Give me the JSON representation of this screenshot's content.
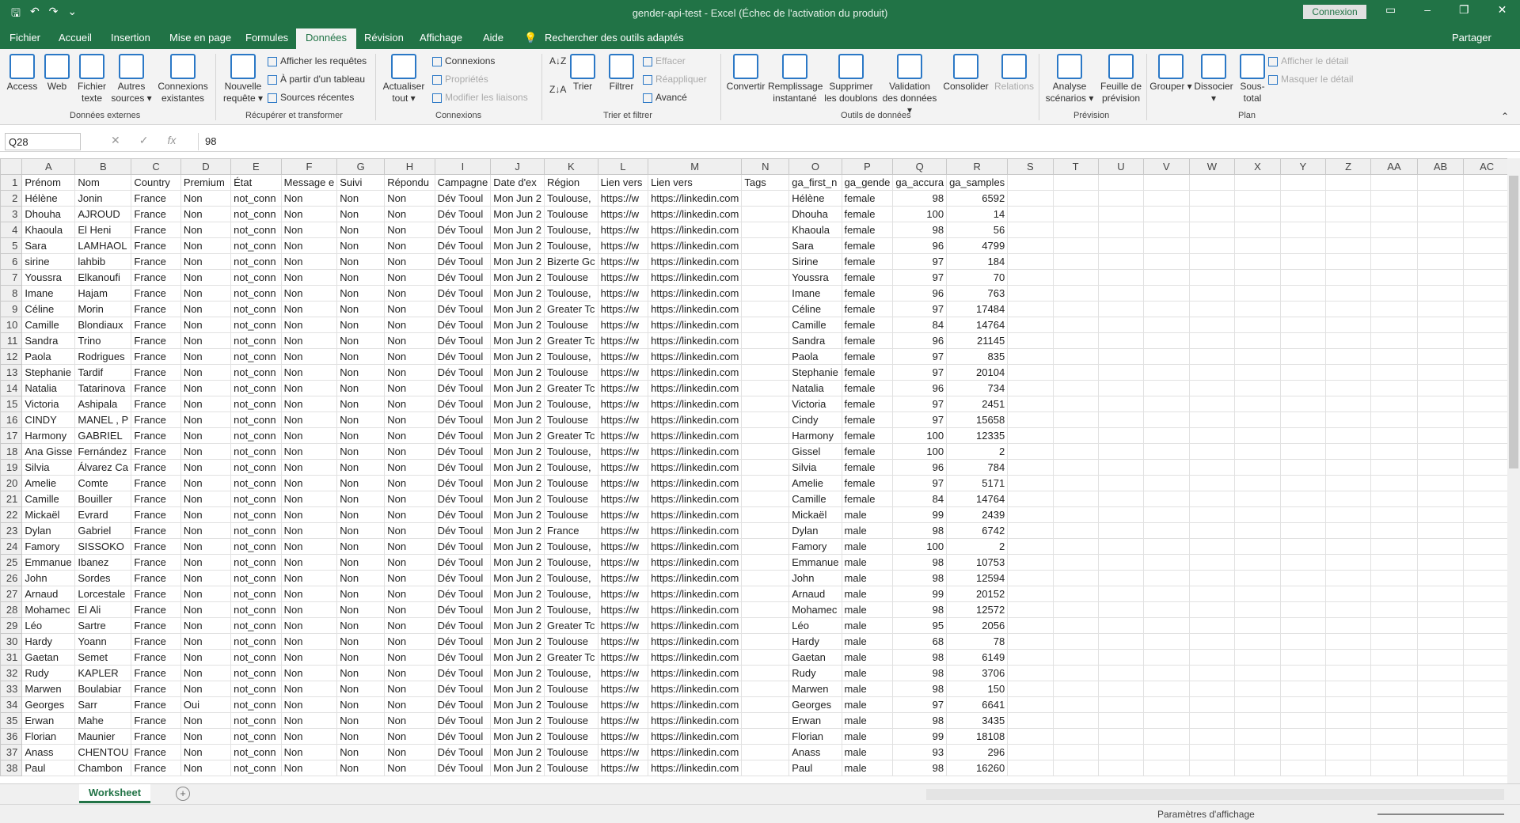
{
  "window": {
    "title": "gender-api-test  -  Excel (Échec de l'activation du produit)",
    "login": "Connexion"
  },
  "tabs": [
    "Fichier",
    "Accueil",
    "Insertion",
    "Mise en page",
    "Formules",
    "Données",
    "Révision",
    "Affichage",
    "Aide"
  ],
  "active_tab": "Données",
  "search": "Rechercher des outils adaptés",
  "share": "Partager",
  "ribbon": {
    "ext": [
      "Access",
      "Web",
      "Fichier texte",
      "Autres sources ▾",
      "Connexions existantes"
    ],
    "ext_group": "Données externes",
    "req": {
      "big": "Nouvelle requête ▾",
      "small": [
        "Afficher les requêtes",
        "À partir d'un tableau",
        "Sources récentes"
      ],
      "group": "Récupérer et transformer"
    },
    "conn": {
      "big": "Actualiser tout ▾",
      "small": [
        "Connexions",
        "Propriétés",
        "Modifier les liaisons"
      ],
      "group": "Connexions"
    },
    "sort": {
      "big": [
        "Trier",
        "Filtrer"
      ],
      "small": [
        "Effacer",
        "Réappliquer",
        "Avancé"
      ],
      "group": "Trier et filtrer"
    },
    "tools": {
      "big": [
        "Convertir",
        "Remplissage instantané",
        "Supprimer les doublons",
        "Validation des données ▾",
        "Consolider",
        "Relations"
      ],
      "group": "Outils de données"
    },
    "prev": {
      "big": [
        "Analyse scénarios ▾",
        "Feuille de prévision"
      ],
      "group": "Prévision"
    },
    "plan": {
      "big": [
        "Grouper ▾",
        "Dissocier ▾",
        "Sous-total"
      ],
      "small": [
        "Afficher le détail",
        "Masquer le détail"
      ],
      "group": "Plan"
    }
  },
  "formula_bar": {
    "name_box": "Q28",
    "value": "98"
  },
  "columns": [
    "A",
    "B",
    "C",
    "D",
    "E",
    "F",
    "G",
    "H",
    "I",
    "J",
    "K",
    "L",
    "M",
    "N",
    "O",
    "P",
    "Q",
    "R",
    "S",
    "T",
    "U",
    "V",
    "W",
    "X",
    "Y",
    "Z",
    "AA",
    "AB",
    "AC"
  ],
  "headers": [
    "Prénom",
    "Nom",
    "Country",
    "Premium",
    "État",
    "Message e",
    "Suivi",
    "Répondu",
    "Campagne",
    "Date d'ex",
    "Région",
    "Lien vers",
    "Lien vers",
    "Tags",
    "ga_first_n",
    "ga_gende",
    "ga_accura",
    "ga_samples"
  ],
  "rows": [
    [
      "Hélène",
      "Jonin",
      "France",
      "Non",
      "not_conn",
      "Non",
      "Non",
      "Non",
      "Dév Tooul",
      "Mon Jun 2",
      "Toulouse,",
      "https://w",
      "https://linkedin.com",
      "",
      "Hélène",
      "female",
      "98",
      "6592"
    ],
    [
      "Dhouha",
      "AJROUD",
      "France",
      "Non",
      "not_conn",
      "Non",
      "Non",
      "Non",
      "Dév Tooul",
      "Mon Jun 2",
      "Toulouse",
      "https://w",
      "https://linkedin.com",
      "",
      "Dhouha",
      "female",
      "100",
      "14"
    ],
    [
      "Khaoula",
      "El Heni",
      "France",
      "Non",
      "not_conn",
      "Non",
      "Non",
      "Non",
      "Dév Tooul",
      "Mon Jun 2",
      "Toulouse,",
      "https://w",
      "https://linkedin.com",
      "",
      "Khaoula",
      "female",
      "98",
      "56"
    ],
    [
      "Sara",
      "LAMHAOL",
      "France",
      "Non",
      "not_conn",
      "Non",
      "Non",
      "Non",
      "Dév Tooul",
      "Mon Jun 2",
      "Toulouse,",
      "https://w",
      "https://linkedin.com",
      "",
      "Sara",
      "female",
      "96",
      "4799"
    ],
    [
      "sirine",
      "lahbib",
      "France",
      "Non",
      "not_conn",
      "Non",
      "Non",
      "Non",
      "Dév Tooul",
      "Mon Jun 2",
      "Bizerte Gc",
      "https://w",
      "https://linkedin.com",
      "",
      "Sirine",
      "female",
      "97",
      "184"
    ],
    [
      "Youssra",
      "Elkanoufi",
      "France",
      "Non",
      "not_conn",
      "Non",
      "Non",
      "Non",
      "Dév Tooul",
      "Mon Jun 2",
      "Toulouse",
      "https://w",
      "https://linkedin.com",
      "",
      "Youssra",
      "female",
      "97",
      "70"
    ],
    [
      "Imane",
      "Hajam",
      "France",
      "Non",
      "not_conn",
      "Non",
      "Non",
      "Non",
      "Dév Tooul",
      "Mon Jun 2",
      "Toulouse,",
      "https://w",
      "https://linkedin.com",
      "",
      "Imane",
      "female",
      "96",
      "763"
    ],
    [
      "Céline",
      "Morin",
      "France",
      "Non",
      "not_conn",
      "Non",
      "Non",
      "Non",
      "Dév Tooul",
      "Mon Jun 2",
      "Greater Tc",
      "https://w",
      "https://linkedin.com",
      "",
      "Céline",
      "female",
      "97",
      "17484"
    ],
    [
      "Camille",
      "Blondiaux",
      "France",
      "Non",
      "not_conn",
      "Non",
      "Non",
      "Non",
      "Dév Tooul",
      "Mon Jun 2",
      "Toulouse",
      "https://w",
      "https://linkedin.com",
      "",
      "Camille",
      "female",
      "84",
      "14764"
    ],
    [
      "Sandra",
      "Trino",
      "France",
      "Non",
      "not_conn",
      "Non",
      "Non",
      "Non",
      "Dév Tooul",
      "Mon Jun 2",
      "Greater Tc",
      "https://w",
      "https://linkedin.com",
      "",
      "Sandra",
      "female",
      "96",
      "21145"
    ],
    [
      "Paola",
      "Rodrigues",
      "France",
      "Non",
      "not_conn",
      "Non",
      "Non",
      "Non",
      "Dév Tooul",
      "Mon Jun 2",
      "Toulouse,",
      "https://w",
      "https://linkedin.com",
      "",
      "Paola",
      "female",
      "97",
      "835"
    ],
    [
      "Stephanie",
      "Tardif",
      "France",
      "Non",
      "not_conn",
      "Non",
      "Non",
      "Non",
      "Dév Tooul",
      "Mon Jun 2",
      "Toulouse",
      "https://w",
      "https://linkedin.com",
      "",
      "Stephanie",
      "female",
      "97",
      "20104"
    ],
    [
      "Natalia",
      "Tatarinova",
      "France",
      "Non",
      "not_conn",
      "Non",
      "Non",
      "Non",
      "Dév Tooul",
      "Mon Jun 2",
      "Greater Tc",
      "https://w",
      "https://linkedin.com",
      "",
      "Natalia",
      "female",
      "96",
      "734"
    ],
    [
      "Victoria",
      "Ashipala",
      "France",
      "Non",
      "not_conn",
      "Non",
      "Non",
      "Non",
      "Dév Tooul",
      "Mon Jun 2",
      "Toulouse,",
      "https://w",
      "https://linkedin.com",
      "",
      "Victoria",
      "female",
      "97",
      "2451"
    ],
    [
      "CINDY",
      "MANEL , P",
      "France",
      "Non",
      "not_conn",
      "Non",
      "Non",
      "Non",
      "Dév Tooul",
      "Mon Jun 2",
      "Toulouse",
      "https://w",
      "https://linkedin.com",
      "",
      "Cindy",
      "female",
      "97",
      "15658"
    ],
    [
      "Harmony",
      "GABRIEL",
      "France",
      "Non",
      "not_conn",
      "Non",
      "Non",
      "Non",
      "Dév Tooul",
      "Mon Jun 2",
      "Greater Tc",
      "https://w",
      "https://linkedin.com",
      "",
      "Harmony",
      "female",
      "100",
      "12335"
    ],
    [
      "Ana Gisse",
      "Fernández",
      "France",
      "Non",
      "not_conn",
      "Non",
      "Non",
      "Non",
      "Dév Tooul",
      "Mon Jun 2",
      "Toulouse,",
      "https://w",
      "https://linkedin.com",
      "",
      "Gissel",
      "female",
      "100",
      "2"
    ],
    [
      "Silvia",
      "Álvarez Ca",
      "France",
      "Non",
      "not_conn",
      "Non",
      "Non",
      "Non",
      "Dév Tooul",
      "Mon Jun 2",
      "Toulouse,",
      "https://w",
      "https://linkedin.com",
      "",
      "Silvia",
      "female",
      "96",
      "784"
    ],
    [
      "Amelie",
      "Comte",
      "France",
      "Non",
      "not_conn",
      "Non",
      "Non",
      "Non",
      "Dév Tooul",
      "Mon Jun 2",
      "Toulouse",
      "https://w",
      "https://linkedin.com",
      "",
      "Amelie",
      "female",
      "97",
      "5171"
    ],
    [
      "Camille",
      "Bouiller",
      "France",
      "Non",
      "not_conn",
      "Non",
      "Non",
      "Non",
      "Dév Tooul",
      "Mon Jun 2",
      "Toulouse",
      "https://w",
      "https://linkedin.com",
      "",
      "Camille",
      "female",
      "84",
      "14764"
    ],
    [
      "Mickaël",
      "Evrard",
      "France",
      "Non",
      "not_conn",
      "Non",
      "Non",
      "Non",
      "Dév Tooul",
      "Mon Jun 2",
      "Toulouse",
      "https://w",
      "https://linkedin.com",
      "",
      "Mickaël",
      "male",
      "99",
      "2439"
    ],
    [
      "Dylan",
      "Gabriel",
      "France",
      "Non",
      "not_conn",
      "Non",
      "Non",
      "Non",
      "Dév Tooul",
      "Mon Jun 2",
      "France",
      "https://w",
      "https://linkedin.com",
      "",
      "Dylan",
      "male",
      "98",
      "6742"
    ],
    [
      "Famory",
      "SISSOKO",
      "France",
      "Non",
      "not_conn",
      "Non",
      "Non",
      "Non",
      "Dév Tooul",
      "Mon Jun 2",
      "Toulouse,",
      "https://w",
      "https://linkedin.com",
      "",
      "Famory",
      "male",
      "100",
      "2"
    ],
    [
      "Emmanue",
      "Ibanez",
      "France",
      "Non",
      "not_conn",
      "Non",
      "Non",
      "Non",
      "Dév Tooul",
      "Mon Jun 2",
      "Toulouse,",
      "https://w",
      "https://linkedin.com",
      "",
      "Emmanue",
      "male",
      "98",
      "10753"
    ],
    [
      "John",
      "Sordes",
      "France",
      "Non",
      "not_conn",
      "Non",
      "Non",
      "Non",
      "Dév Tooul",
      "Mon Jun 2",
      "Toulouse,",
      "https://w",
      "https://linkedin.com",
      "",
      "John",
      "male",
      "98",
      "12594"
    ],
    [
      "Arnaud",
      "Lorcestale",
      "France",
      "Non",
      "not_conn",
      "Non",
      "Non",
      "Non",
      "Dév Tooul",
      "Mon Jun 2",
      "Toulouse,",
      "https://w",
      "https://linkedin.com",
      "",
      "Arnaud",
      "male",
      "99",
      "20152"
    ],
    [
      "Mohamec",
      "El Ali",
      "France",
      "Non",
      "not_conn",
      "Non",
      "Non",
      "Non",
      "Dév Tooul",
      "Mon Jun 2",
      "Toulouse,",
      "https://w",
      "https://linkedin.com",
      "",
      "Mohamec",
      "male",
      "98",
      "12572"
    ],
    [
      "Léo",
      "Sartre",
      "France",
      "Non",
      "not_conn",
      "Non",
      "Non",
      "Non",
      "Dév Tooul",
      "Mon Jun 2",
      "Greater Tc",
      "https://w",
      "https://linkedin.com",
      "",
      "Léo",
      "male",
      "95",
      "2056"
    ],
    [
      "Hardy",
      "Yoann",
      "France",
      "Non",
      "not_conn",
      "Non",
      "Non",
      "Non",
      "Dév Tooul",
      "Mon Jun 2",
      "Toulouse",
      "https://w",
      "https://linkedin.com",
      "",
      "Hardy",
      "male",
      "68",
      "78"
    ],
    [
      "Gaetan",
      "Semet",
      "France",
      "Non",
      "not_conn",
      "Non",
      "Non",
      "Non",
      "Dév Tooul",
      "Mon Jun 2",
      "Greater Tc",
      "https://w",
      "https://linkedin.com",
      "",
      "Gaetan",
      "male",
      "98",
      "6149"
    ],
    [
      "Rudy",
      "KAPLER",
      "France",
      "Non",
      "not_conn",
      "Non",
      "Non",
      "Non",
      "Dév Tooul",
      "Mon Jun 2",
      "Toulouse,",
      "https://w",
      "https://linkedin.com",
      "",
      "Rudy",
      "male",
      "98",
      "3706"
    ],
    [
      "Marwen",
      "Boulabiar",
      "France",
      "Non",
      "not_conn",
      "Non",
      "Non",
      "Non",
      "Dév Tooul",
      "Mon Jun 2",
      "Toulouse",
      "https://w",
      "https://linkedin.com",
      "",
      "Marwen",
      "male",
      "98",
      "150"
    ],
    [
      "Georges",
      "Sarr",
      "France",
      "Oui",
      "not_conn",
      "Non",
      "Non",
      "Non",
      "Dév Tooul",
      "Mon Jun 2",
      "Toulouse",
      "https://w",
      "https://linkedin.com",
      "",
      "Georges",
      "male",
      "97",
      "6641"
    ],
    [
      "Erwan",
      "Mahe",
      "France",
      "Non",
      "not_conn",
      "Non",
      "Non",
      "Non",
      "Dév Tooul",
      "Mon Jun 2",
      "Toulouse",
      "https://w",
      "https://linkedin.com",
      "",
      "Erwan",
      "male",
      "98",
      "3435"
    ],
    [
      "Florian",
      "Maunier",
      "France",
      "Non",
      "not_conn",
      "Non",
      "Non",
      "Non",
      "Dév Tooul",
      "Mon Jun 2",
      "Toulouse",
      "https://w",
      "https://linkedin.com",
      "",
      "Florian",
      "male",
      "99",
      "18108"
    ],
    [
      "Anass",
      "CHENTOU",
      "France",
      "Non",
      "not_conn",
      "Non",
      "Non",
      "Non",
      "Dév Tooul",
      "Mon Jun 2",
      "Toulouse",
      "https://w",
      "https://linkedin.com",
      "",
      "Anass",
      "male",
      "93",
      "296"
    ],
    [
      "Paul",
      "Chambon",
      "France",
      "Non",
      "not_conn",
      "Non",
      "Non",
      "Non",
      "Dév Tooul",
      "Mon Jun 2",
      "Toulouse",
      "https://w",
      "https://linkedin.com",
      "",
      "Paul",
      "male",
      "98",
      "16260"
    ]
  ],
  "sheet_tab": "Worksheet",
  "status": {
    "display_settings": "Paramètres d'affichage"
  }
}
